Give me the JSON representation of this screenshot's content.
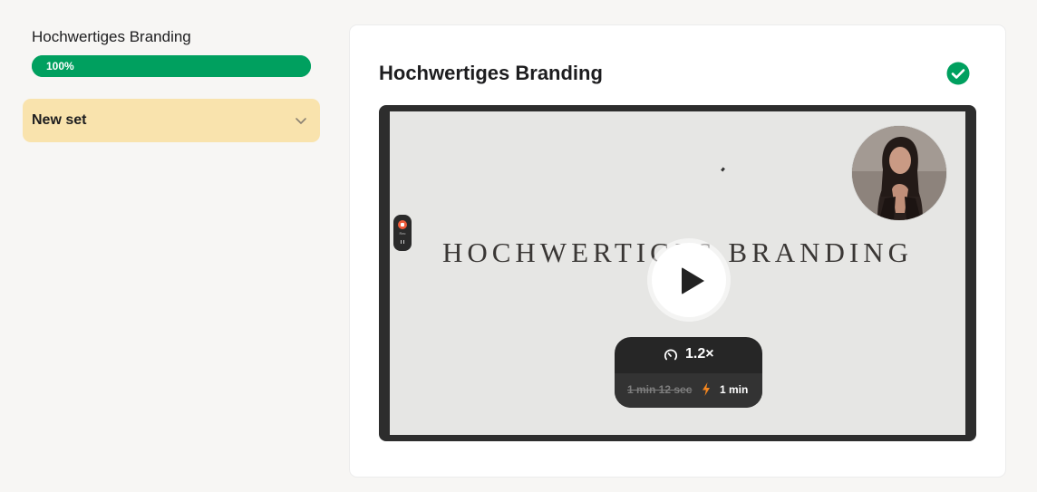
{
  "sidebar": {
    "course_title": "Hochwertiges Branding",
    "progress": {
      "percent_label": "100%",
      "value": 1.0
    },
    "set": {
      "label": "New set"
    }
  },
  "lesson": {
    "title": "Hochwertiges Branding",
    "completed": true,
    "video": {
      "headline": "HOCHWERTIGES BRANDING",
      "speed_label": "1.2×",
      "original_duration": "1 min 12 sec",
      "new_duration": "1 min",
      "recorder_label": "Rec"
    }
  },
  "colors": {
    "accent_green": "#00a05f",
    "set_background": "#f9e3ad",
    "page_background": "#f7f6f4",
    "bolt": "#f4861f"
  },
  "icons": {
    "set_chevron": "chevron-down-icon",
    "completed": "check-circle-icon",
    "play": "play-icon",
    "speed": "speedometer-icon",
    "boost": "lightning-icon"
  }
}
